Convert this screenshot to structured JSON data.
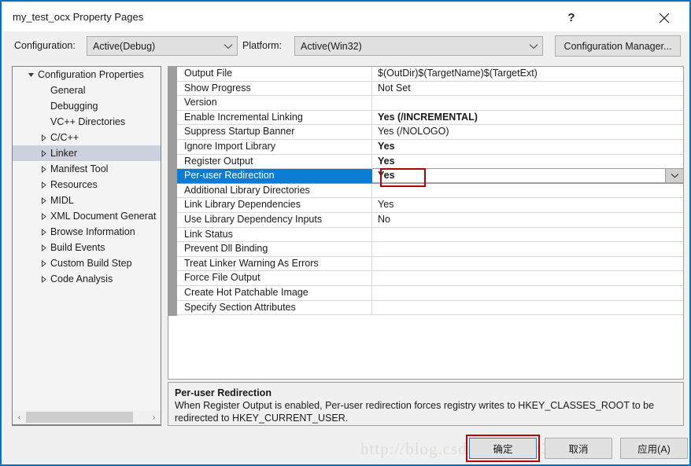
{
  "window": {
    "title": "my_test_ocx Property Pages",
    "help_icon": "?",
    "close_icon": "close-icon"
  },
  "configbar": {
    "configuration_label": "Configuration:",
    "configuration_value": "Active(Debug)",
    "platform_label": "Platform:",
    "platform_value": "Active(Win32)",
    "configuration_manager_label": "Configuration Manager..."
  },
  "tree": {
    "items": [
      {
        "label": "Configuration Properties",
        "level": 0,
        "expander": "expanded",
        "selected": false
      },
      {
        "label": "General",
        "level": 1,
        "expander": "none",
        "selected": false
      },
      {
        "label": "Debugging",
        "level": 1,
        "expander": "none",
        "selected": false
      },
      {
        "label": "VC++ Directories",
        "level": 1,
        "expander": "none",
        "selected": false
      },
      {
        "label": "C/C++",
        "level": 1,
        "expander": "collapsed",
        "selected": false
      },
      {
        "label": "Linker",
        "level": 1,
        "expander": "collapsed",
        "selected": true
      },
      {
        "label": "Manifest Tool",
        "level": 1,
        "expander": "collapsed",
        "selected": false
      },
      {
        "label": "Resources",
        "level": 1,
        "expander": "collapsed",
        "selected": false
      },
      {
        "label": "MIDL",
        "level": 1,
        "expander": "collapsed",
        "selected": false
      },
      {
        "label": "XML Document Generat",
        "level": 1,
        "expander": "collapsed",
        "selected": false
      },
      {
        "label": "Browse Information",
        "level": 1,
        "expander": "collapsed",
        "selected": false
      },
      {
        "label": "Build Events",
        "level": 1,
        "expander": "collapsed",
        "selected": false
      },
      {
        "label": "Custom Build Step",
        "level": 1,
        "expander": "collapsed",
        "selected": false
      },
      {
        "label": "Code Analysis",
        "level": 1,
        "expander": "collapsed",
        "selected": false
      }
    ],
    "scrollbar": {
      "left_arrow": "‹",
      "right_arrow": "›"
    }
  },
  "grid": {
    "rows": [
      {
        "name": "Output File",
        "value": "$(OutDir)$(TargetName)$(TargetExt)",
        "bold": false,
        "selected": false
      },
      {
        "name": "Show Progress",
        "value": "Not Set",
        "bold": false,
        "selected": false
      },
      {
        "name": "Version",
        "value": "",
        "bold": false,
        "selected": false
      },
      {
        "name": "Enable Incremental Linking",
        "value": "Yes (/INCREMENTAL)",
        "bold": true,
        "selected": false
      },
      {
        "name": "Suppress Startup Banner",
        "value": "Yes (/NOLOGO)",
        "bold": false,
        "selected": false
      },
      {
        "name": "Ignore Import Library",
        "value": "Yes",
        "bold": true,
        "selected": false
      },
      {
        "name": "Register Output",
        "value": "Yes",
        "bold": true,
        "selected": false
      },
      {
        "name": "Per-user Redirection",
        "value": "Yes",
        "bold": true,
        "selected": true
      },
      {
        "name": "Additional Library Directories",
        "value": "",
        "bold": false,
        "selected": false
      },
      {
        "name": "Link Library Dependencies",
        "value": "Yes",
        "bold": false,
        "selected": false
      },
      {
        "name": "Use Library Dependency Inputs",
        "value": "No",
        "bold": false,
        "selected": false
      },
      {
        "name": "Link Status",
        "value": "",
        "bold": false,
        "selected": false
      },
      {
        "name": "Prevent Dll Binding",
        "value": "",
        "bold": false,
        "selected": false
      },
      {
        "name": "Treat Linker Warning As Errors",
        "value": "",
        "bold": false,
        "selected": false
      },
      {
        "name": "Force File Output",
        "value": "",
        "bold": false,
        "selected": false
      },
      {
        "name": "Create Hot Patchable Image",
        "value": "",
        "bold": false,
        "selected": false
      },
      {
        "name": "Specify Section Attributes",
        "value": "",
        "bold": false,
        "selected": false
      }
    ]
  },
  "description": {
    "title": "Per-user Redirection",
    "body": "When Register Output is enabled, Per-user redirection forces registry writes to HKEY_CLASSES_ROOT to be redirected to HKEY_CURRENT_USER."
  },
  "buttons": {
    "ok": "确定",
    "cancel": "取消",
    "apply": "应用(A)"
  },
  "watermark": {
    "text": "http://blog.csdn.net/Lost3speed"
  },
  "colors": {
    "frame": "#0072c6",
    "selection_tree": "#cdd1dd",
    "selection_grid": "#0a7cd3",
    "highlight_box": "#b40000",
    "dialog_bg": "#f0f0f0"
  }
}
